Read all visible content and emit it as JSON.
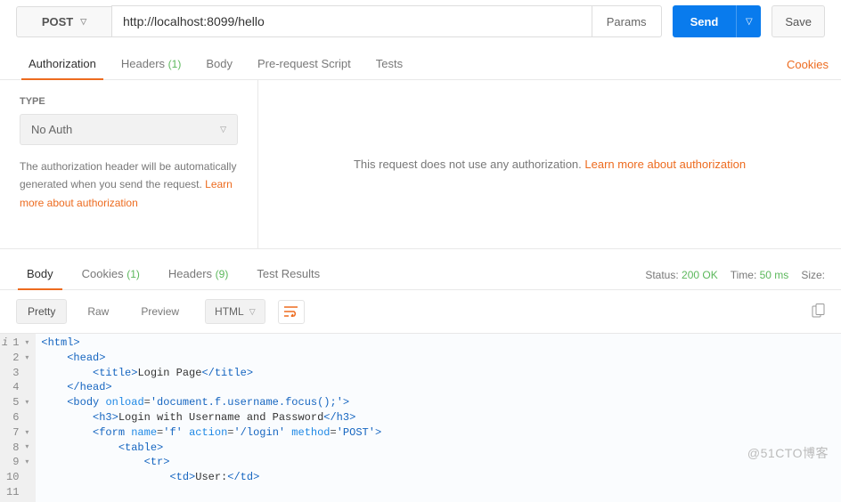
{
  "request": {
    "method": "POST",
    "url": "http://localhost:8099/hello",
    "params_label": "Params",
    "send_label": "Send",
    "save_label": "Save"
  },
  "req_tabs": {
    "authorization": "Authorization",
    "headers": "Headers",
    "headers_count": "(1)",
    "body": "Body",
    "pre_request": "Pre-request Script",
    "tests": "Tests",
    "cookies_link": "Cookies"
  },
  "auth": {
    "type_label": "TYPE",
    "type_value": "No Auth",
    "help_text_1": "The authorization header will be automatically generated when you send the request. ",
    "help_link_1": "Learn more about authorization",
    "right_text": "This request does not use any authorization. ",
    "right_link": "Learn more about authorization"
  },
  "resp_tabs": {
    "body": "Body",
    "cookies": "Cookies",
    "cookies_count": "(1)",
    "headers": "Headers",
    "headers_count": "(9)",
    "test_results": "Test Results"
  },
  "resp_status": {
    "status_label": "Status:",
    "status_value": "200 OK",
    "time_label": "Time:",
    "time_value": "50 ms",
    "size_label": "Size:"
  },
  "view": {
    "pretty": "Pretty",
    "raw": "Raw",
    "preview": "Preview",
    "lang": "HTML"
  },
  "code_lines": [
    {
      "n": 1,
      "fold": true,
      "info": true,
      "indent": 0,
      "html": "<span class='tagc'>&lt;html&gt;</span>"
    },
    {
      "n": 2,
      "fold": true,
      "indent": 1,
      "html": "<span class='tagc'>&lt;head&gt;</span>"
    },
    {
      "n": 3,
      "indent": 2,
      "html": "<span class='tagc'>&lt;title&gt;</span><span class='txt'>Login Page</span><span class='tagc'>&lt;/title&gt;</span>"
    },
    {
      "n": 4,
      "indent": 1,
      "html": "<span class='tagc'>&lt;/head&gt;</span>"
    },
    {
      "n": 5,
      "fold": true,
      "indent": 1,
      "html": "<span class='tagc'>&lt;body</span> <span class='attrn'>onload</span>=<span class='attrv'>'document.f.username.focus();'</span><span class='tagc'>&gt;</span>"
    },
    {
      "n": 6,
      "indent": 2,
      "html": "<span class='tagc'>&lt;h3&gt;</span><span class='txt'>Login with Username and Password</span><span class='tagc'>&lt;/h3&gt;</span>"
    },
    {
      "n": 7,
      "fold": true,
      "indent": 2,
      "html": "<span class='tagc'>&lt;form</span> <span class='attrn'>name</span>=<span class='attrv'>'f'</span> <span class='attrn'>action</span>=<span class='attrv'>'/login'</span> <span class='attrn'>method</span>=<span class='attrv'>'POST'</span><span class='tagc'>&gt;</span>"
    },
    {
      "n": 8,
      "fold": true,
      "indent": 3,
      "html": "<span class='tagc'>&lt;table&gt;</span>"
    },
    {
      "n": 9,
      "fold": true,
      "indent": 4,
      "html": "<span class='tagc'>&lt;tr&gt;</span>"
    },
    {
      "n": 10,
      "indent": 5,
      "html": "<span class='tagc'>&lt;td&gt;</span><span class='txt'>User:</span><span class='tagc'>&lt;/td&gt;</span>"
    },
    {
      "n": 11,
      "indent": 5,
      "html": ""
    }
  ],
  "watermark": "@51CTO博客"
}
